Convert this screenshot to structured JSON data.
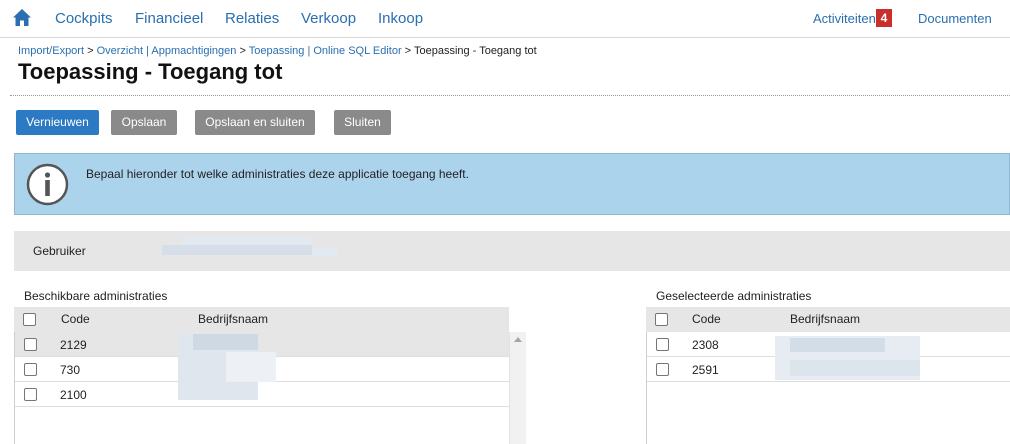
{
  "nav": {
    "home_icon": "home-icon",
    "items": [
      "Cockpits",
      "Financieel",
      "Relaties",
      "Verkoop",
      "Inkoop"
    ],
    "activities_label": "Activiteiten",
    "activities_count": "4",
    "documents_label": "Documenten"
  },
  "breadcrumb": {
    "links": [
      "Import/Export",
      "Overzicht | Appmachtigingen",
      "Toepassing | Online SQL Editor"
    ],
    "separator": " > ",
    "current": "Toepassing - Toegang tot"
  },
  "page_title": "Toepassing - Toegang tot",
  "toolbar": {
    "refresh_label": "Vernieuwen",
    "save_label": "Opslaan",
    "save_close_label": "Opslaan en sluiten",
    "close_label": "Sluiten"
  },
  "info": {
    "icon": "info-icon",
    "text": "Bepaal hieronder tot welke administraties deze applicatie toegang heeft."
  },
  "user": {
    "label": "Gebruiker"
  },
  "available": {
    "title": "Beschikbare administraties",
    "columns": [
      "Code",
      "Bedrijfsnaam"
    ],
    "rows": [
      {
        "code": "2129",
        "selected": true
      },
      {
        "code": "730",
        "selected": false
      },
      {
        "code": "2100",
        "selected": false
      }
    ]
  },
  "chosen": {
    "title": "Geselecteerde administraties",
    "columns": [
      "Code",
      "Bedrijfsnaam"
    ],
    "rows": [
      {
        "code": "2308"
      },
      {
        "code": "2591"
      }
    ]
  },
  "colors": {
    "link": "#2a6fb0",
    "primary_button": "#2c7ac4",
    "grey_button": "#8a8a8a",
    "badge": "#c9302c",
    "info_bg": "#acd3ec"
  }
}
